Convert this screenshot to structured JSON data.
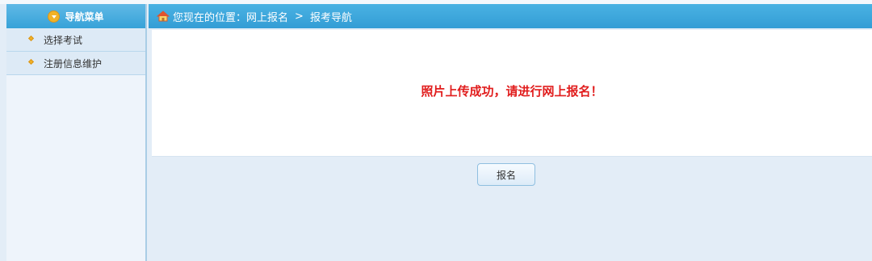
{
  "sidebar": {
    "title": "导航菜单",
    "items": [
      {
        "label": "选择考试"
      },
      {
        "label": "注册信息维护"
      }
    ]
  },
  "breadcrumb": {
    "prefix": "您现在的位置：",
    "path1": "网上报名",
    "separator": ">",
    "path2": "报考导航"
  },
  "main": {
    "message": "照片上传成功，请进行网上报名！",
    "button_label": "报名"
  },
  "colors": {
    "header_blue": "#37a2d8",
    "message_red": "#e11d1d",
    "bullet_orange": "#f2b226"
  }
}
